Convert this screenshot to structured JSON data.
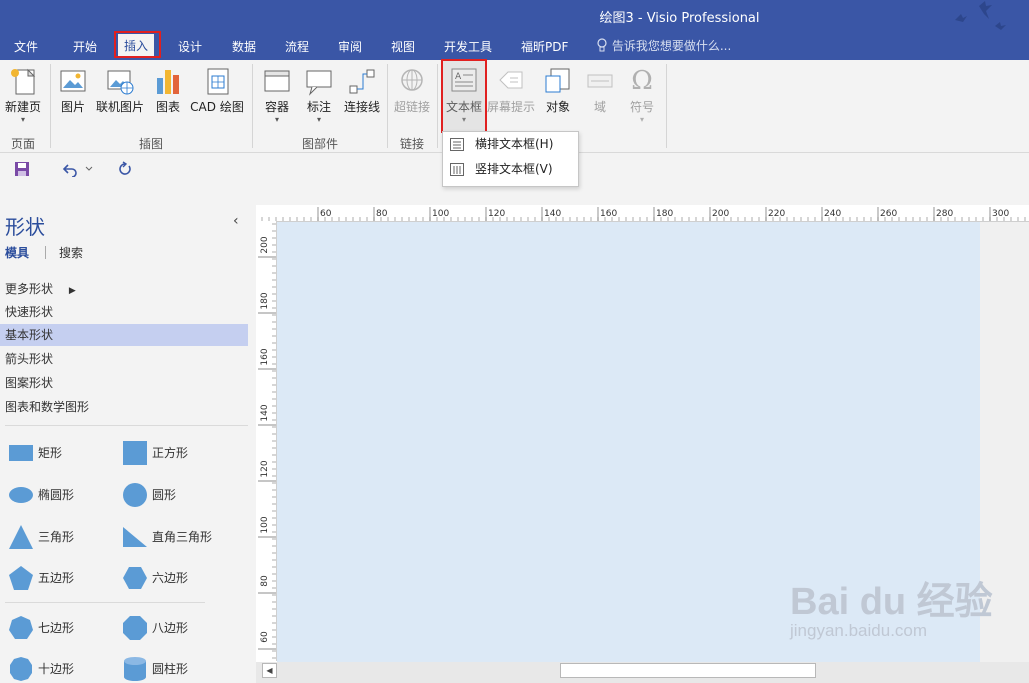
{
  "window": {
    "title": "绘图3 - Visio Professional"
  },
  "tabs": [
    {
      "label": "文件"
    },
    {
      "label": "开始"
    },
    {
      "label": "插入"
    },
    {
      "label": "设计"
    },
    {
      "label": "数据"
    },
    {
      "label": "流程"
    },
    {
      "label": "审阅"
    },
    {
      "label": "视图"
    },
    {
      "label": "开发工具"
    },
    {
      "label": "福昕PDF"
    }
  ],
  "tell_me": {
    "text": "告诉我您想要做什么..."
  },
  "ribbon": {
    "groups": [
      {
        "label": "页面"
      },
      {
        "label": "插图"
      },
      {
        "label": "图部件"
      },
      {
        "label": "链接"
      }
    ],
    "buttons": {
      "new_page": "新建页",
      "picture": "图片",
      "online_picture": "联机图片",
      "chart": "图表",
      "cad": "CAD 绘图",
      "container": "容器",
      "callout": "标注",
      "connector": "连接线",
      "hyperlink": "超链接",
      "textbox": "文本框",
      "screentip": "屏幕提示",
      "object": "对象",
      "field": "域",
      "symbol": "符号"
    },
    "symbol_glyph": "Ω"
  },
  "textbox_menu": [
    {
      "label": "横排文本框(H)"
    },
    {
      "label": "竖排文本框(V)"
    }
  ],
  "shapes_pane": {
    "title": "形状",
    "collapse_glyph": "‹",
    "tab_stencils": "模具",
    "tab_search": "搜索",
    "more_shapes": "更多形状",
    "stencils": [
      "快速形状",
      "基本形状",
      "箭头形状",
      "图案形状",
      "图表和数学图形"
    ],
    "selected_stencil": "基本形状",
    "shapes": [
      {
        "label": "矩形"
      },
      {
        "label": "正方形"
      },
      {
        "label": "椭圆形"
      },
      {
        "label": "圆形"
      },
      {
        "label": "三角形"
      },
      {
        "label": "直角三角形"
      },
      {
        "label": "五边形"
      },
      {
        "label": "六边形"
      },
      {
        "label": "七边形"
      },
      {
        "label": "八边形"
      },
      {
        "label": "十边形"
      },
      {
        "label": "圆柱形"
      }
    ]
  },
  "rulers": {
    "horizontal": [
      "60",
      "80",
      "100",
      "120",
      "140",
      "160",
      "180",
      "200",
      "220",
      "240",
      "260",
      "280",
      "300"
    ],
    "vertical": [
      "200",
      "180",
      "160",
      "140",
      "120",
      "100",
      "80",
      "60"
    ]
  },
  "watermark": {
    "brand": "Bai du 经验",
    "url": "jingyan.baidu.com"
  },
  "colors": {
    "accent": "#3a56a6",
    "shape_fill": "#5b9bd5",
    "page_bg": "#dce9f6",
    "highlight": "#e02020"
  }
}
